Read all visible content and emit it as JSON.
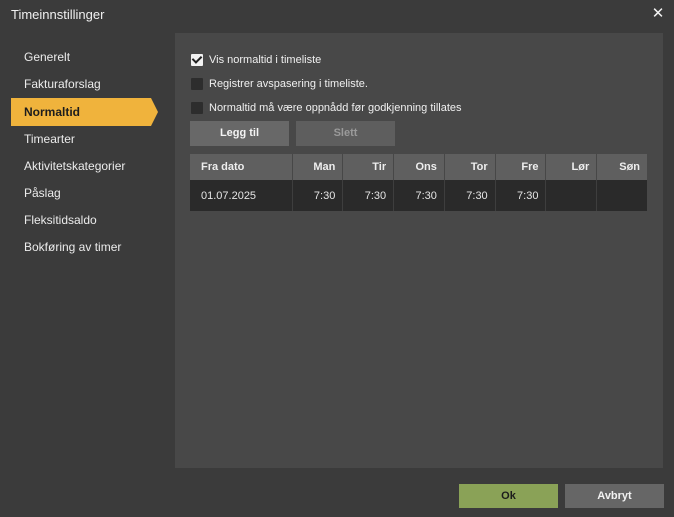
{
  "window": {
    "title": "Timeinnstillinger",
    "close_symbol": "✕"
  },
  "sidebar": {
    "items": [
      {
        "label": "Generelt",
        "active": false
      },
      {
        "label": "Fakturaforslag",
        "active": false
      },
      {
        "label": "Normaltid",
        "active": true
      },
      {
        "label": "Timearter",
        "active": false
      },
      {
        "label": "Aktivitetskategorier",
        "active": false
      },
      {
        "label": "Påslag",
        "active": false
      },
      {
        "label": "Fleksitidsaldo",
        "active": false
      },
      {
        "label": "Bokføring av timer",
        "active": false
      }
    ]
  },
  "options": [
    {
      "label": "Vis normaltid i timeliste",
      "checked": true
    },
    {
      "label": "Registrer avspasering i timeliste.",
      "checked": false
    },
    {
      "label": "Normaltid må være oppnådd før godkjenning tillates",
      "checked": false
    }
  ],
  "toolbar": {
    "add_label": "Legg til",
    "delete_label": "Slett"
  },
  "table": {
    "headers": [
      "Fra dato",
      "Man",
      "Tir",
      "Ons",
      "Tor",
      "Fre",
      "Lør",
      "Søn"
    ],
    "rows": [
      [
        "01.07.2025",
        "7:30",
        "7:30",
        "7:30",
        "7:30",
        "7:30",
        "",
        ""
      ]
    ]
  },
  "footer": {
    "ok_label": "Ok",
    "cancel_label": "Avbryt"
  },
  "colors": {
    "accent": "#f0b33c",
    "ok": "#8aa257",
    "background": "#3b3b3b",
    "panel": "#484848"
  }
}
